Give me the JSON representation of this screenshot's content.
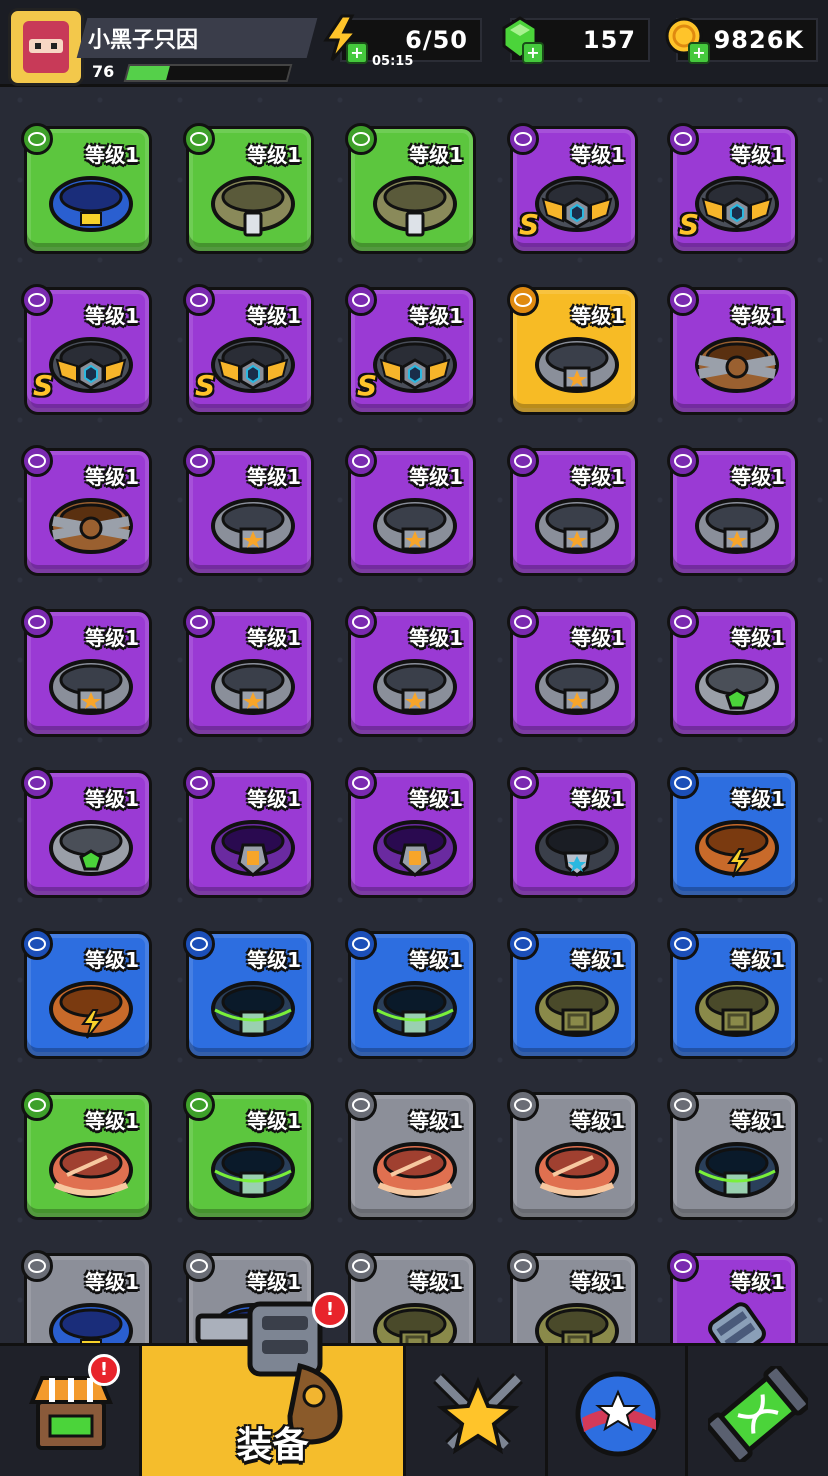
{
  "player": {
    "name": "小黑子只因",
    "level": "76",
    "xp_progress": 0.25
  },
  "resources": {
    "energy": {
      "value": "6/50",
      "timer": "05:15",
      "icon": "lightning-icon"
    },
    "gems": {
      "value": "157",
      "icon": "green-gem-icon"
    },
    "coins": {
      "value": "9826K",
      "icon": "gold-coin-icon"
    }
  },
  "colors": {
    "green": "#5cc63e",
    "purple": "#9a3ad4",
    "blue": "#2d6ee0",
    "gold": "#f7bb25",
    "gray": "#8c8f99",
    "nav_active": "#f5bd2c"
  },
  "level_label": "等级1",
  "items": [
    {
      "rarity": "green",
      "kind": "blue-belt"
    },
    {
      "rarity": "green",
      "kind": "tag-collar"
    },
    {
      "rarity": "green",
      "kind": "tag-collar"
    },
    {
      "rarity": "purple",
      "kind": "winged-belt",
      "s": true
    },
    {
      "rarity": "purple",
      "kind": "winged-belt",
      "s": true
    },
    {
      "rarity": "purple",
      "kind": "winged-belt",
      "s": true
    },
    {
      "rarity": "purple",
      "kind": "winged-belt",
      "s": true
    },
    {
      "rarity": "purple",
      "kind": "winged-belt",
      "s": true
    },
    {
      "rarity": "gold",
      "kind": "star-ring"
    },
    {
      "rarity": "purple",
      "kind": "rope-belt"
    },
    {
      "rarity": "purple",
      "kind": "rope-belt"
    },
    {
      "rarity": "purple",
      "kind": "star-ring"
    },
    {
      "rarity": "purple",
      "kind": "star-ring"
    },
    {
      "rarity": "purple",
      "kind": "star-ring"
    },
    {
      "rarity": "purple",
      "kind": "star-ring"
    },
    {
      "rarity": "purple",
      "kind": "star-ring"
    },
    {
      "rarity": "purple",
      "kind": "star-ring"
    },
    {
      "rarity": "purple",
      "kind": "star-ring"
    },
    {
      "rarity": "purple",
      "kind": "star-ring"
    },
    {
      "rarity": "purple",
      "kind": "gem-ring"
    },
    {
      "rarity": "purple",
      "kind": "gem-ring"
    },
    {
      "rarity": "purple",
      "kind": "shield-belt"
    },
    {
      "rarity": "purple",
      "kind": "shield-belt"
    },
    {
      "rarity": "purple",
      "kind": "blue-star-belt"
    },
    {
      "rarity": "blue",
      "kind": "bolt-collar"
    },
    {
      "rarity": "blue",
      "kind": "bolt-collar"
    },
    {
      "rarity": "blue",
      "kind": "green-belt"
    },
    {
      "rarity": "blue",
      "kind": "green-belt"
    },
    {
      "rarity": "blue",
      "kind": "buckle-belt"
    },
    {
      "rarity": "blue",
      "kind": "buckle-belt"
    },
    {
      "rarity": "green",
      "kind": "cloth-belt"
    },
    {
      "rarity": "green",
      "kind": "green-belt"
    },
    {
      "rarity": "gray",
      "kind": "cloth-belt"
    },
    {
      "rarity": "gray",
      "kind": "cloth-belt"
    },
    {
      "rarity": "gray",
      "kind": "green-belt"
    },
    {
      "rarity": "gray",
      "kind": "blue-belt"
    },
    {
      "rarity": "gray",
      "kind": "blue-belt"
    },
    {
      "rarity": "gray",
      "kind": "buckle-belt"
    },
    {
      "rarity": "gray",
      "kind": "buckle-belt"
    },
    {
      "rarity": "purple",
      "kind": "gauntlet",
      "glove": true
    }
  ],
  "nav": [
    {
      "name": "shop",
      "icon": "shop-icon",
      "alert": true
    },
    {
      "name": "equipment",
      "label": "装备",
      "icon": "revolver-icon",
      "alert": true,
      "active": true
    },
    {
      "name": "battle",
      "icon": "crossed-swords-star-icon"
    },
    {
      "name": "talents",
      "icon": "star-orb-icon"
    },
    {
      "name": "evolution",
      "icon": "dna-capsule-icon"
    }
  ]
}
